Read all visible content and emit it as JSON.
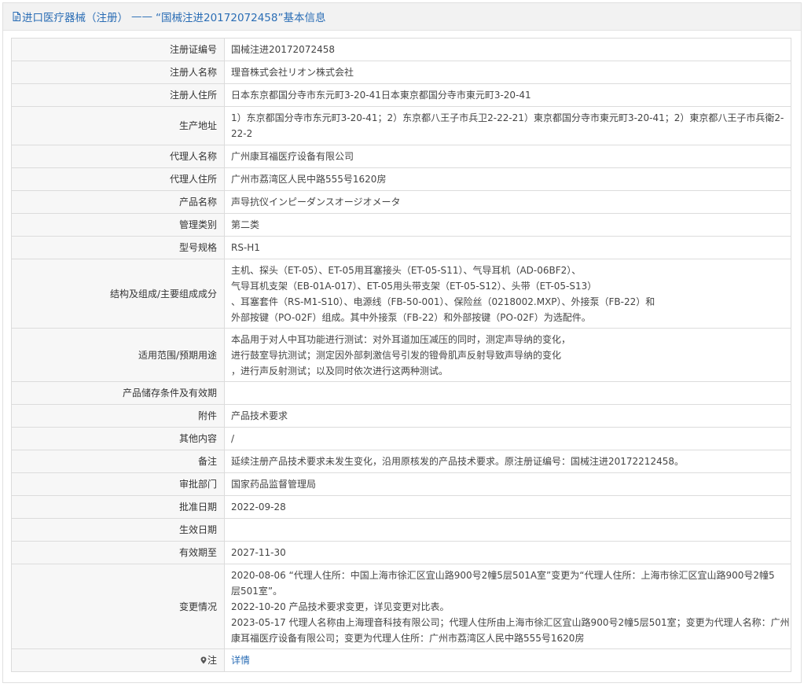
{
  "header": {
    "title_prefix": "进口医疗器械（注册）",
    "title_sep": "——",
    "title_main": "“国械注进20172072458”基本信息"
  },
  "rows": {
    "reg_no": {
      "label": "注册证编号",
      "value": "国械注进20172072458"
    },
    "registrant": {
      "label": "注册人名称",
      "value": "理音株式会社リオン株式会社"
    },
    "registrant_addr": {
      "label": "注册人住所",
      "value": "日本东京都国分寺市东元町3-20-41日本東京都国分寺市東元町3-20-41"
    },
    "mfg_addr": {
      "label": "生产地址",
      "value": "1）东京都国分寺市东元町3-20-41；2）东京都八王子市兵卫2-22-21）東京都国分寺市東元町3-20-41；2）東京都八王子市兵衛2-22-2"
    },
    "agent": {
      "label": "代理人名称",
      "value": "广州康耳福医疗设备有限公司"
    },
    "agent_addr": {
      "label": "代理人住所",
      "value": "广州市荔湾区人民中路555号1620房"
    },
    "product": {
      "label": "产品名称",
      "value": "声导抗仪インピーダンスオージオメータ"
    },
    "category": {
      "label": "管理类别",
      "value": "第二类"
    },
    "model": {
      "label": "型号规格",
      "value": "RS-H1"
    },
    "structure": {
      "label": "结构及组成/主要组成成分",
      "lines": [
        "主机、探头（ET-05）、ET-05用耳塞接头（ET-05-S11）、气导耳机（AD-06BF2）、",
        "气导耳机支架（EB-01A-017）、ET-05用头带支架（ET-05-S12）、头带（ET-05-S13）",
        "、耳塞套件（RS-M1-S10）、电源线（FB-50-001）、保险丝（0218002.MXP）、外接泵（FB-22）和",
        "外部按键（PO-02F）组成。其中外接泵（FB-22）和外部按键（PO-02F）为选配件。"
      ]
    },
    "scope": {
      "label": "适用范围/预期用途",
      "lines": [
        "本品用于对人中耳功能进行测试：对外耳道加压减压的同时，测定声导纳的变化，",
        "进行鼓室导抗测试；测定因外部刺激信号引发的镫骨肌声反射导致声导纳的变化",
        "，进行声反射测试；以及同时依次进行这两种测试。"
      ]
    },
    "storage": {
      "label": "产品储存条件及有效期",
      "value": ""
    },
    "attachment": {
      "label": "附件",
      "value": "产品技术要求"
    },
    "other": {
      "label": "其他内容",
      "value": "/"
    },
    "remark": {
      "label": "备注",
      "value": "延续注册产品技术要求未发生变化，沿用原核发的产品技术要求。原注册证编号：国械注进20172212458。"
    },
    "dept": {
      "label": "审批部门",
      "value": "国家药品监督管理局"
    },
    "approval_date": {
      "label": "批准日期",
      "value": "2022-09-28"
    },
    "effective_date": {
      "label": "生效日期",
      "value": ""
    },
    "expiry": {
      "label": "有效期至",
      "value": "2027-11-30"
    },
    "changes": {
      "label": "变更情况",
      "lines": [
        "2020-08-06 “代理人住所：中国上海市徐汇区宜山路900号2幢5层501A室”变更为“代理人住所：上海市徐汇区宜山路900号2幢5",
        "层501室”。",
        "2022-10-20 产品技术要求变更，详见变更对比表。",
        "2023-05-17 代理人名称由上海理音科技有限公司；代理人住所由上海市徐汇区宜山路900号2幢5层501室；变更为代理人名称：广州",
        "康耳福医疗设备有限公司；变更为代理人住所：广州市荔湾区人民中路555号1620房"
      ]
    },
    "note": {
      "label": "注",
      "link": "详情"
    }
  },
  "colors": {
    "accent": "#2a6db5",
    "label_bg": "#f7f7f7",
    "header_bg": "#f2f2f2",
    "border": "#dcdcdc"
  },
  "icons": {
    "title": "document-icon",
    "note": "location-pin-icon"
  }
}
